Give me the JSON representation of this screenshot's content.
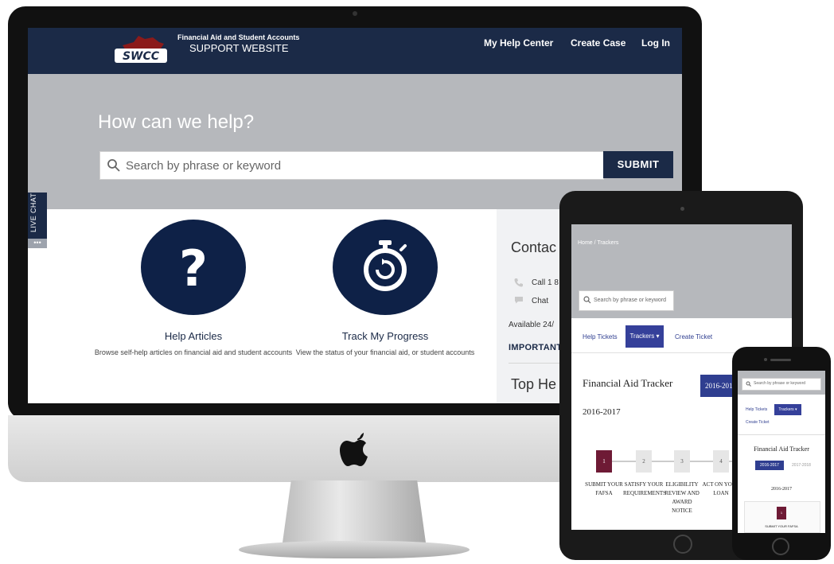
{
  "desktop": {
    "nav": {
      "logo_text": "SWCC",
      "brand_line1": "Financial Aid and Student Accounts",
      "brand_line2": "SUPPORT WEBSITE",
      "links": [
        "My Help Center",
        "Create Case",
        "Log In"
      ]
    },
    "hero": {
      "title": "How can we help?",
      "search_placeholder": "Search by phrase or keyword",
      "submit_label": "SUBMIT"
    },
    "cards": [
      {
        "title": "Help Articles",
        "description": "Browse self-help articles on financial aid and student accounts",
        "icon": "question-mark-icon"
      },
      {
        "title": "Track My Progress",
        "description": "View the status of your financial aid, or student accounts",
        "icon": "stopwatch-icon"
      }
    ],
    "contact": {
      "title": "Contac",
      "phone": "Call 1 8",
      "chat": "Chat",
      "available": "Available 24/",
      "important": "IMPORTANT",
      "top_heading": "Top He"
    },
    "live_chat_label": "LIVE CHAT",
    "live_chat_dots": "•••"
  },
  "tablet": {
    "breadcrumb": "Home / Trackers",
    "search_placeholder": "Search by phrase or keyword",
    "tabs": [
      "Help Tickets",
      "Trackers ▾",
      "Create Ticket"
    ],
    "title": "Financial Aid Tracker",
    "year_button": "2016-2017",
    "year_heading": "2016-2017",
    "steps": [
      {
        "num": "1",
        "label": "SUBMIT YOUR FAFSA",
        "active": true
      },
      {
        "num": "2",
        "label": "SATISFY YOUR REQUIREMENTS",
        "active": false
      },
      {
        "num": "3",
        "label": "ELIGIBILITY REVIEW AND AWARD NOTICE",
        "active": false
      },
      {
        "num": "4",
        "label": "ACT ON YOUR LOAN",
        "active": false
      }
    ]
  },
  "phone": {
    "search_placeholder": "Search by phrase or keyword",
    "help_tickets": "Help Tickets",
    "trackers": "Trackers ▾",
    "create_ticket": "Create Ticket",
    "title": "Financial Aid Tracker",
    "year_active": "2016-2017",
    "year_inactive": "2017-2018",
    "year_heading": "2016-2017",
    "step_num": "1",
    "step_label": "SUBMIT YOUR FAFSA"
  },
  "colors": {
    "navy": "#1b2a47",
    "circle": "#0e2147",
    "hero_gray": "#b6b8bc",
    "accent_blue": "#35409a",
    "step_active": "#6e1a35"
  }
}
